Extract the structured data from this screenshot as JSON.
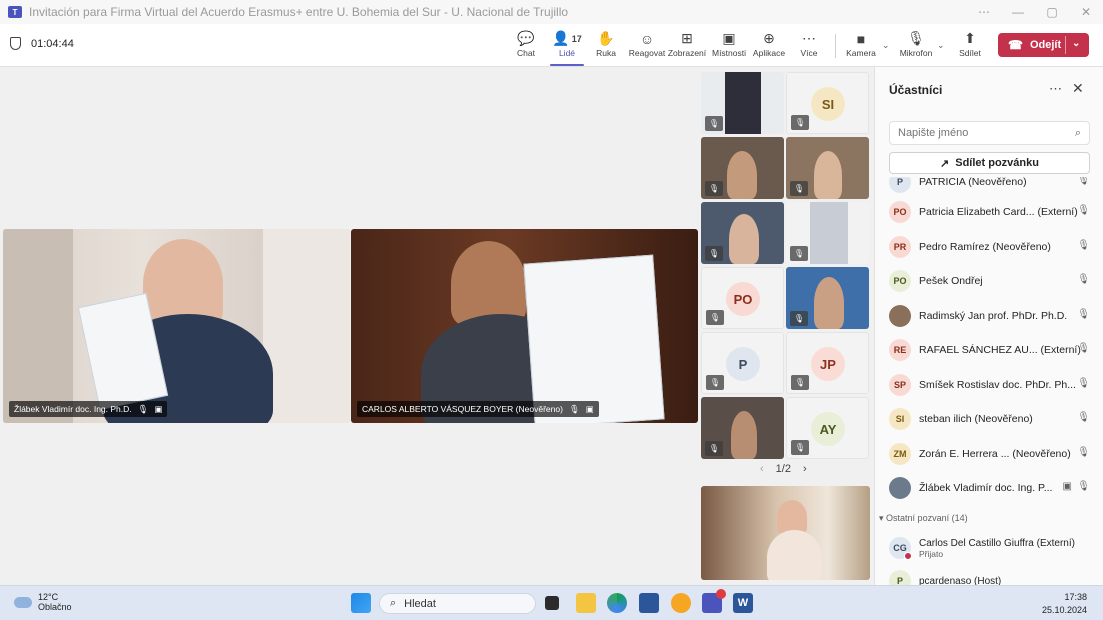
{
  "window": {
    "title": "Invitación para Firma Virtual del Acuerdo Erasmus+ entre U. Bohemia del Sur - U. Nacional de Trujillo"
  },
  "toolbar": {
    "timer": "01:04:44",
    "people_count": "17",
    "buttons": [
      {
        "label": "Chat",
        "icon": "chat-icon"
      },
      {
        "label": "Lidé",
        "icon": "people-icon"
      },
      {
        "label": "Ruka",
        "icon": "hand-icon"
      },
      {
        "label": "Reagovat",
        "icon": "emoji-icon"
      },
      {
        "label": "Zobrazení",
        "icon": "grid-icon"
      },
      {
        "label": "Místnosti",
        "icon": "rooms-icon"
      },
      {
        "label": "Aplikace",
        "icon": "plus-icon"
      },
      {
        "label": "Více",
        "icon": "more-icon"
      },
      {
        "label": "Kamera",
        "icon": "camera-icon"
      },
      {
        "label": "Mikrofon",
        "icon": "mic-icon"
      },
      {
        "label": "Sdílet",
        "icon": "share-icon"
      }
    ],
    "leave_label": "Odejít",
    "leave_color": "#c4314b",
    "accent_color": "#5b5fc7"
  },
  "stage": {
    "main_videos": [
      {
        "name": "Žlábek Vladimír doc. Ing. Ph.D."
      },
      {
        "name": "CARLOS ALBERTO VÁSQUEZ BOYER (Neověřeno)"
      }
    ],
    "gallery_avatars": [
      {
        "initials": "SI",
        "bg": "#f5e7c4",
        "fg": "#7a5a10"
      },
      {
        "initials": "PO",
        "bg": "#f9d9d3",
        "fg": "#8a2e1c"
      },
      {
        "initials": "P",
        "bg": "#dfe6ef",
        "fg": "#3a4a5c"
      },
      {
        "initials": "JP",
        "bg": "#f9dcd5",
        "fg": "#8a3320"
      },
      {
        "initials": "AY",
        "bg": "#e9eed9",
        "fg": "#4a5a1c"
      }
    ],
    "pager": "1/2"
  },
  "panel": {
    "title": "Účastníci",
    "search_placeholder": "Napište jméno",
    "share_label": "Sdílet pozvánku",
    "participants": [
      {
        "initials": "P",
        "name": "PATRICIA (Neověřeno)",
        "bg": "#dfe6ef",
        "fg": "#3a4a5c"
      },
      {
        "initials": "PO",
        "name": "Patricia Elizabeth Card... (Externí)",
        "bg": "#f9d9d3",
        "fg": "#8a2e1c"
      },
      {
        "initials": "PR",
        "name": "Pedro Ramírez (Neověřeno)",
        "bg": "#f9d9d3",
        "fg": "#8a2e1c"
      },
      {
        "initials": "PO",
        "name": "Pešek Ondřej",
        "bg": "#e9eed9",
        "fg": "#4a5a1c"
      },
      {
        "initials": "",
        "name": "Radimský Jan prof. PhDr. Ph.D.",
        "bg": "#8a6f5a",
        "fg": "#ffffff"
      },
      {
        "initials": "RE",
        "name": "RAFAEL SÁNCHEZ AU... (Externí)",
        "bg": "#f9d9d3",
        "fg": "#8a2e1c"
      },
      {
        "initials": "SP",
        "name": "Smíšek Rostislav doc. PhDr. Ph...",
        "bg": "#f9d9d3",
        "fg": "#8a2e1c"
      },
      {
        "initials": "SI",
        "name": "steban ilich (Neověřeno)",
        "bg": "#f5e7c4",
        "fg": "#7a5a10"
      },
      {
        "initials": "ZM",
        "name": "Zorán E. Herrera ... (Neověřeno)",
        "bg": "#f5e7c4",
        "fg": "#7a5a10"
      },
      {
        "initials": "",
        "name": "Žlábek Vladimír doc. Ing. P...",
        "bg": "#6b7b8c",
        "fg": "#ffffff"
      }
    ],
    "invited_section": "Ostatní pozvaní (14)",
    "invited": [
      {
        "initials": "CG",
        "name": "Carlos Del Castillo Giuffra (Externí)",
        "status": "Přijato",
        "bg": "#dfe6ef",
        "fg": "#3a4a5c"
      },
      {
        "initials": "P",
        "name": "pcardenaso (Host)",
        "status": "",
        "bg": "#e9eed9",
        "fg": "#4a5a1c"
      }
    ]
  },
  "taskbar": {
    "temperature": "12°C",
    "weather": "Oblačno",
    "search_label": "Hledat",
    "time": "17:38",
    "date": "25.10.2024"
  }
}
